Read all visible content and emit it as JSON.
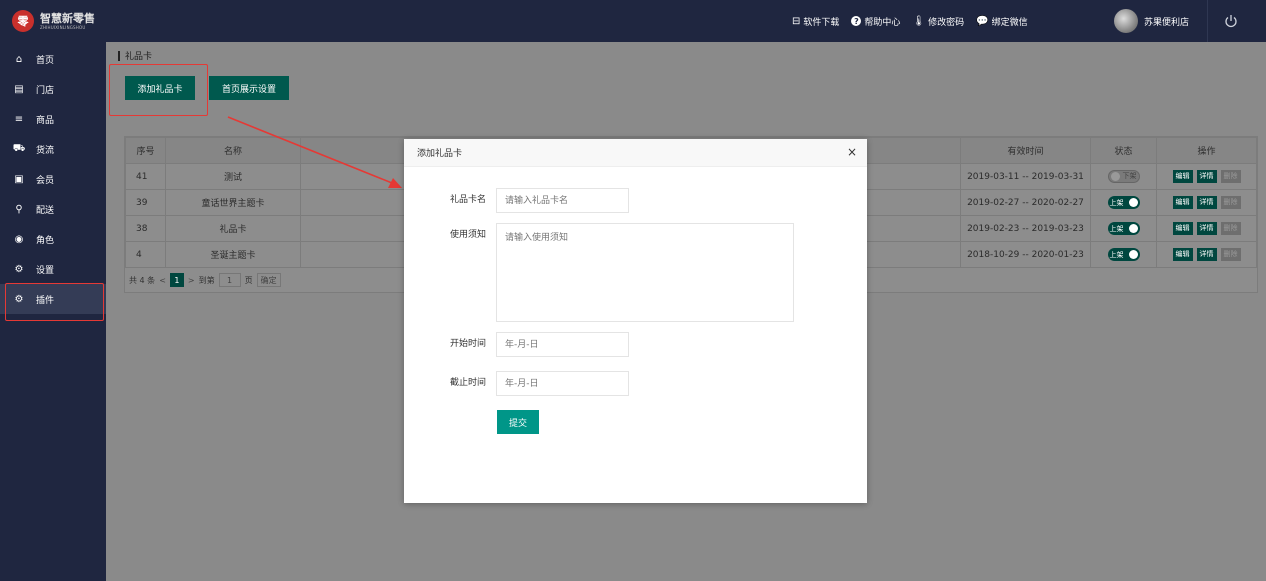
{
  "brand": {
    "logo_char": "零",
    "name_cn": "智慧新零售",
    "name_en": "ZHIHUIXINLINGSHOU"
  },
  "top_links": [
    {
      "icon": "download-icon",
      "glyph": "⊟",
      "label": "软件下载"
    },
    {
      "icon": "help-icon",
      "glyph": "?",
      "label": "帮助中心"
    },
    {
      "icon": "thermometer-icon",
      "glyph": "🌡",
      "label": "修改密码"
    },
    {
      "icon": "wechat-icon",
      "glyph": "💬",
      "label": "绑定微信"
    }
  ],
  "user": {
    "shop_name": "苏果便利店"
  },
  "sidebar": {
    "items": [
      {
        "icon": "home-icon",
        "glyph": "⌂",
        "label": "首页"
      },
      {
        "icon": "store-icon",
        "glyph": "▤",
        "label": "门店"
      },
      {
        "icon": "list-icon",
        "glyph": "≡",
        "label": "商品"
      },
      {
        "icon": "truck-icon",
        "glyph": "⛟",
        "label": "货流"
      },
      {
        "icon": "member-card-icon",
        "glyph": "▣",
        "label": "会员"
      },
      {
        "icon": "motorcycle-icon",
        "glyph": "⚲",
        "label": "配送"
      },
      {
        "icon": "role-icon",
        "glyph": "◉",
        "label": "角色"
      },
      {
        "icon": "gear-icon",
        "glyph": "⚙",
        "label": "设置"
      },
      {
        "icon": "plugin-icon",
        "glyph": "⚙",
        "label": "插件"
      }
    ]
  },
  "breadcrumb": "礼品卡",
  "toolbar": {
    "add_label": "添加礼品卡",
    "home_display_label": "首页展示设置"
  },
  "table": {
    "headers": [
      "序号",
      "名称",
      "有效时间",
      "状态",
      "操作"
    ],
    "rows": [
      {
        "id": "41",
        "name": "测试",
        "validity": "2019-03-11 -- 2019-03-31",
        "status": "下架",
        "on": false
      },
      {
        "id": "39",
        "name": "童话世界主题卡",
        "validity": "2019-02-27 -- 2020-02-27",
        "status": "上架",
        "on": true
      },
      {
        "id": "38",
        "name": "礼品卡",
        "validity": "2019-02-23 -- 2019-03-23",
        "status": "上架",
        "on": true
      },
      {
        "id": "4",
        "name": "圣诞主题卡",
        "validity": "2018-10-29 -- 2020-01-23",
        "status": "上架",
        "on": true
      }
    ],
    "ops": {
      "edit": "编辑",
      "detail": "详情",
      "delete": "删除"
    }
  },
  "pager": {
    "total": "共 4 条",
    "prev": "<",
    "current": "1",
    "next": ">",
    "goto": "到第",
    "page_input": "1",
    "page_unit": "页",
    "confirm": "确定"
  },
  "modal": {
    "title": "添加礼品卡",
    "close": "×",
    "fields": {
      "name_label": "礼品卡名",
      "name_placeholder": "请输入礼品卡名",
      "notice_label": "使用须知",
      "notice_placeholder": "请输入使用须知",
      "start_label": "开始时间",
      "start_placeholder": "年-月-日",
      "end_label": "截止时间",
      "end_placeholder": "年-月-日"
    },
    "submit": "提交"
  },
  "colors": {
    "topbar": "#1f2640",
    "accent": "#009688",
    "highlight": "#e53935"
  }
}
